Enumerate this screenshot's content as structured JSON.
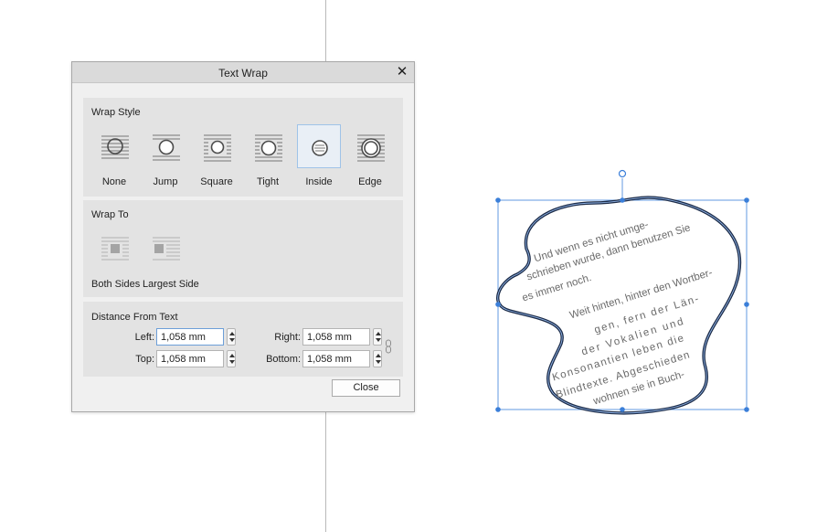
{
  "dialog": {
    "title": "Text Wrap",
    "close_glyph": "✕",
    "wrap_style": {
      "label": "Wrap Style",
      "options": [
        {
          "label": "None",
          "icon": "wrap-none-icon",
          "selected": false
        },
        {
          "label": "Jump",
          "icon": "wrap-jump-icon",
          "selected": false
        },
        {
          "label": "Square",
          "icon": "wrap-square-icon",
          "selected": false
        },
        {
          "label": "Tight",
          "icon": "wrap-tight-icon",
          "selected": false
        },
        {
          "label": "Inside",
          "icon": "wrap-inside-icon",
          "selected": true
        },
        {
          "label": "Edge",
          "icon": "wrap-edge-icon",
          "selected": false
        }
      ]
    },
    "wrap_to": {
      "label": "Wrap To",
      "options": [
        {
          "label": "Both Sides",
          "icon": "wrap-both-sides-icon",
          "enabled": false
        },
        {
          "label": "Largest Side",
          "icon": "wrap-largest-side-icon",
          "enabled": false
        }
      ]
    },
    "distance": {
      "label": "Distance From Text",
      "left": {
        "label": "Left:",
        "value": "1,058 mm"
      },
      "top": {
        "label": "Top:",
        "value": "1,058 mm"
      },
      "right": {
        "label": "Right:",
        "value": "1,058 mm"
      },
      "bottom": {
        "label": "Bottom:",
        "value": "1,058 mm"
      }
    },
    "close_button": "Close"
  },
  "canvas": {
    "shape_outline_color": "#1c2b47",
    "selection_color": "#3b7fd9",
    "text_lines": [
      "Und wenn es nicht umge-",
      "schrieben wurde, dann benutzen Sie",
      "es immer noch.",
      "Weit hinten, hinter den Wortber-",
      "gen, fern der Län-",
      "der Vokalien und",
      "Konsonantien leben die",
      "Blindtexte. Abgeschieden",
      "wohnen sie in Buch-"
    ]
  }
}
